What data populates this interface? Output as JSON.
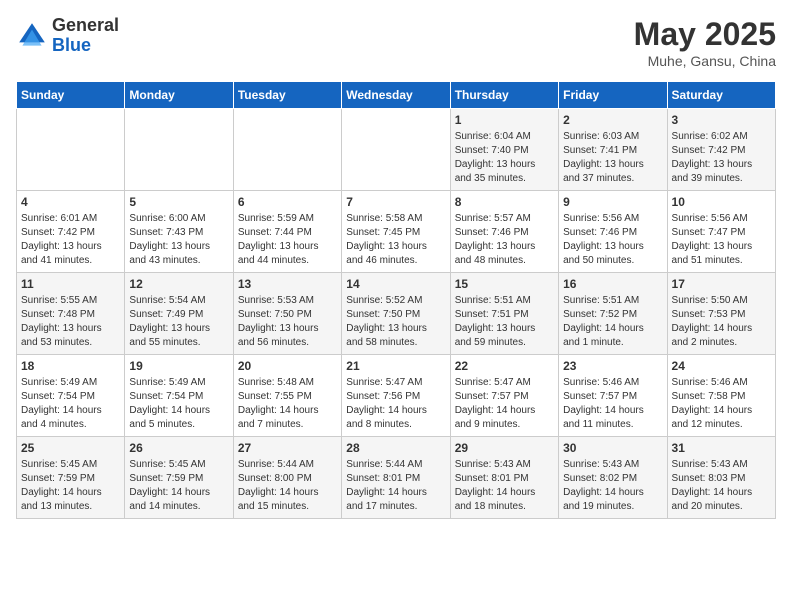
{
  "header": {
    "logo_general": "General",
    "logo_blue": "Blue",
    "month_title": "May 2025",
    "location": "Muhe, Gansu, China"
  },
  "weekdays": [
    "Sunday",
    "Monday",
    "Tuesday",
    "Wednesday",
    "Thursday",
    "Friday",
    "Saturday"
  ],
  "weeks": [
    [
      {
        "day": "",
        "detail": ""
      },
      {
        "day": "",
        "detail": ""
      },
      {
        "day": "",
        "detail": ""
      },
      {
        "day": "",
        "detail": ""
      },
      {
        "day": "1",
        "detail": "Sunrise: 6:04 AM\nSunset: 7:40 PM\nDaylight: 13 hours\nand 35 minutes."
      },
      {
        "day": "2",
        "detail": "Sunrise: 6:03 AM\nSunset: 7:41 PM\nDaylight: 13 hours\nand 37 minutes."
      },
      {
        "day": "3",
        "detail": "Sunrise: 6:02 AM\nSunset: 7:42 PM\nDaylight: 13 hours\nand 39 minutes."
      }
    ],
    [
      {
        "day": "4",
        "detail": "Sunrise: 6:01 AM\nSunset: 7:42 PM\nDaylight: 13 hours\nand 41 minutes."
      },
      {
        "day": "5",
        "detail": "Sunrise: 6:00 AM\nSunset: 7:43 PM\nDaylight: 13 hours\nand 43 minutes."
      },
      {
        "day": "6",
        "detail": "Sunrise: 5:59 AM\nSunset: 7:44 PM\nDaylight: 13 hours\nand 44 minutes."
      },
      {
        "day": "7",
        "detail": "Sunrise: 5:58 AM\nSunset: 7:45 PM\nDaylight: 13 hours\nand 46 minutes."
      },
      {
        "day": "8",
        "detail": "Sunrise: 5:57 AM\nSunset: 7:46 PM\nDaylight: 13 hours\nand 48 minutes."
      },
      {
        "day": "9",
        "detail": "Sunrise: 5:56 AM\nSunset: 7:46 PM\nDaylight: 13 hours\nand 50 minutes."
      },
      {
        "day": "10",
        "detail": "Sunrise: 5:56 AM\nSunset: 7:47 PM\nDaylight: 13 hours\nand 51 minutes."
      }
    ],
    [
      {
        "day": "11",
        "detail": "Sunrise: 5:55 AM\nSunset: 7:48 PM\nDaylight: 13 hours\nand 53 minutes."
      },
      {
        "day": "12",
        "detail": "Sunrise: 5:54 AM\nSunset: 7:49 PM\nDaylight: 13 hours\nand 55 minutes."
      },
      {
        "day": "13",
        "detail": "Sunrise: 5:53 AM\nSunset: 7:50 PM\nDaylight: 13 hours\nand 56 minutes."
      },
      {
        "day": "14",
        "detail": "Sunrise: 5:52 AM\nSunset: 7:50 PM\nDaylight: 13 hours\nand 58 minutes."
      },
      {
        "day": "15",
        "detail": "Sunrise: 5:51 AM\nSunset: 7:51 PM\nDaylight: 13 hours\nand 59 minutes."
      },
      {
        "day": "16",
        "detail": "Sunrise: 5:51 AM\nSunset: 7:52 PM\nDaylight: 14 hours\nand 1 minute."
      },
      {
        "day": "17",
        "detail": "Sunrise: 5:50 AM\nSunset: 7:53 PM\nDaylight: 14 hours\nand 2 minutes."
      }
    ],
    [
      {
        "day": "18",
        "detail": "Sunrise: 5:49 AM\nSunset: 7:54 PM\nDaylight: 14 hours\nand 4 minutes."
      },
      {
        "day": "19",
        "detail": "Sunrise: 5:49 AM\nSunset: 7:54 PM\nDaylight: 14 hours\nand 5 minutes."
      },
      {
        "day": "20",
        "detail": "Sunrise: 5:48 AM\nSunset: 7:55 PM\nDaylight: 14 hours\nand 7 minutes."
      },
      {
        "day": "21",
        "detail": "Sunrise: 5:47 AM\nSunset: 7:56 PM\nDaylight: 14 hours\nand 8 minutes."
      },
      {
        "day": "22",
        "detail": "Sunrise: 5:47 AM\nSunset: 7:57 PM\nDaylight: 14 hours\nand 9 minutes."
      },
      {
        "day": "23",
        "detail": "Sunrise: 5:46 AM\nSunset: 7:57 PM\nDaylight: 14 hours\nand 11 minutes."
      },
      {
        "day": "24",
        "detail": "Sunrise: 5:46 AM\nSunset: 7:58 PM\nDaylight: 14 hours\nand 12 minutes."
      }
    ],
    [
      {
        "day": "25",
        "detail": "Sunrise: 5:45 AM\nSunset: 7:59 PM\nDaylight: 14 hours\nand 13 minutes."
      },
      {
        "day": "26",
        "detail": "Sunrise: 5:45 AM\nSunset: 7:59 PM\nDaylight: 14 hours\nand 14 minutes."
      },
      {
        "day": "27",
        "detail": "Sunrise: 5:44 AM\nSunset: 8:00 PM\nDaylight: 14 hours\nand 15 minutes."
      },
      {
        "day": "28",
        "detail": "Sunrise: 5:44 AM\nSunset: 8:01 PM\nDaylight: 14 hours\nand 17 minutes."
      },
      {
        "day": "29",
        "detail": "Sunrise: 5:43 AM\nSunset: 8:01 PM\nDaylight: 14 hours\nand 18 minutes."
      },
      {
        "day": "30",
        "detail": "Sunrise: 5:43 AM\nSunset: 8:02 PM\nDaylight: 14 hours\nand 19 minutes."
      },
      {
        "day": "31",
        "detail": "Sunrise: 5:43 AM\nSunset: 8:03 PM\nDaylight: 14 hours\nand 20 minutes."
      }
    ]
  ]
}
